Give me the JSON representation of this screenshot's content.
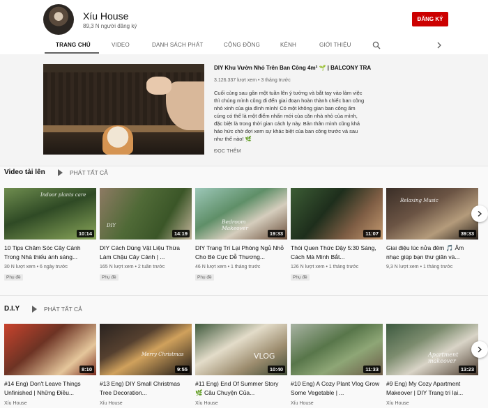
{
  "channel": {
    "name": "Xíu House",
    "subscribers": "89,3 N người đăng ký",
    "subscribe_label": "ĐĂNG KÝ"
  },
  "tabs": [
    {
      "label": "TRANG CHỦ",
      "active": true
    },
    {
      "label": "VIDEO"
    },
    {
      "label": "DANH SÁCH PHÁT"
    },
    {
      "label": "CỘNG ĐỒNG"
    },
    {
      "label": "KÊNH"
    },
    {
      "label": "GIỚI THIỆU"
    }
  ],
  "featured": {
    "title": "DIY Khu Vườn Nhỏ Trên Ban Công 4m² 🌱 | BALCONY TRAN...",
    "meta": "3.126.337 lượt xem • 3 tháng trước",
    "description": "Cuối cùng sau gần một tuần lên ý tưởng và bắt tay vào làm việc thì chúng mình cũng đi đến giai đoạn hoàn thành chiếc ban công nhỏ xinh của gia đình mình! Có một không gian ban công ấm cúng có thể là một điểm nhấn mới của căn nhà nhỏ của mình, đặc biệt là trong thời gian cách ly này. Bản thân mình cũng khá háo hức chờ đợi xem sự khác biệt của ban công trước và sau như thế nào! 🌿",
    "read_more": "ĐỌC THÊM"
  },
  "uploads": {
    "title": "Video tải lên",
    "play_all": "PHÁT TẤT CẢ",
    "videos": [
      {
        "title": "10 Tips Chăm Sóc Cây Cảnh Trong Nhà thiếu ánh sáng...",
        "meta": "30 N lượt xem • 6 ngày trước",
        "duration": "10:14",
        "badge": "Phụ đề",
        "overlay": "Indoor plants care"
      },
      {
        "title": "DIY Cách Dùng Vật Liệu Thừa Làm Chậu Cây Cảnh | ...",
        "meta": "165 N lượt xem • 2 tuần trước",
        "duration": "14:19",
        "badge": "Phụ đề",
        "overlay": "DIY"
      },
      {
        "title": "DIY Trang Trí Lại Phòng Ngủ Nhỏ Cho Bé Cực Dễ Thương...",
        "meta": "46 N lượt xem • 1 tháng trước",
        "duration": "19:33",
        "badge": "Phụ đề",
        "overlay": "Bedroom Makeover"
      },
      {
        "title": "Thói Quen Thức Dậy 5:30 Sáng, Cách Mà Mình Bắt...",
        "meta": "126 N lượt xem • 1 tháng trước",
        "duration": "11:07",
        "badge": "Phụ đề",
        "overlay": ""
      },
      {
        "title": "Giai điệu lúc nửa đêm 🎵 Âm nhạc giúp bạn thư giãn và...",
        "meta": "9,3 N lượt xem • 1 tháng trước",
        "duration": "39:33",
        "badge": "",
        "overlay": "Relaxing Music"
      }
    ]
  },
  "diy": {
    "title": "D.I.Y",
    "play_all": "PHÁT TẤT CẢ",
    "videos": [
      {
        "title": "#14 Eng) Don't Leave Things Unfinished | Những Điều...",
        "channel": "Xíu House",
        "duration": "8:10",
        "overlay": ""
      },
      {
        "title": "#13 Eng) DIY Small Christmas Tree Decoration...",
        "channel": "Xíu House",
        "duration": "9:55",
        "overlay": "Merry Christmas"
      },
      {
        "title": "#11 Eng) End Of Summer Story 🌿 Câu Chuyện Của...",
        "channel": "Xíu House",
        "duration": "10:40",
        "overlay": "VLOG"
      },
      {
        "title": "#10 Eng) A Cozy Plant Vlog Grow Some Vegetable | ...",
        "channel": "Xíu House",
        "duration": "11:33",
        "overlay": ""
      },
      {
        "title": "#9 Eng) My Cozy Apartment Makeover | DIY Trang trí lại...",
        "channel": "Xíu House",
        "duration": "13:23",
        "overlay": "Apartment makeover"
      }
    ]
  },
  "colors": {
    "brand_red": "#cc0000",
    "text_secondary": "#606060"
  },
  "icons": [
    "search-icon",
    "chevron-right-icon",
    "play-icon"
  ]
}
